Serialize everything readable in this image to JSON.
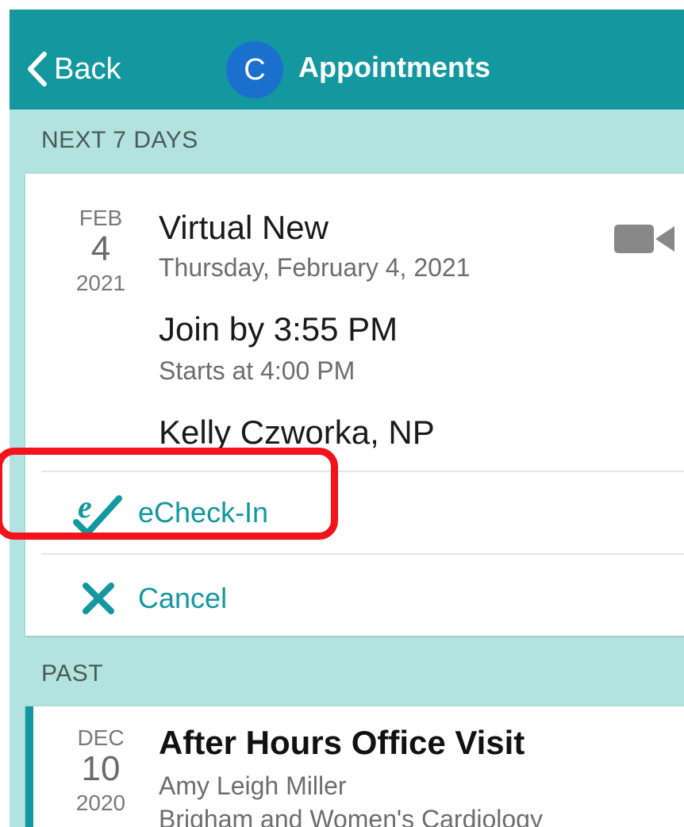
{
  "header": {
    "back_label": "Back",
    "avatar_initial": "C",
    "title": "Appointments",
    "background_color": "#13989f",
    "avatar_color": "#1b6fcd"
  },
  "sections": {
    "next": "NEXT 7 DAYS",
    "past": "PAST"
  },
  "upcoming": {
    "month": "FEB",
    "day": "4",
    "year": "2021",
    "title": "Virtual New",
    "date_long": "Thursday, February 4, 2021",
    "join_by": "Join by 3:55 PM",
    "starts_at": "Starts at 4:00 PM",
    "provider": "Kelly Czworka, NP",
    "type_icon": "video-camera-icon",
    "actions": [
      {
        "label": "eCheck-In",
        "icon": "echeck-in-icon"
      },
      {
        "label": "Cancel",
        "icon": "cancel-x-icon"
      }
    ]
  },
  "past": {
    "month": "DEC",
    "day": "10",
    "year": "2020",
    "title": "After Hours Office Visit",
    "provider": "Amy Leigh Miller",
    "location": "Brigham and Women's Cardiology"
  },
  "colors": {
    "accent": "#13989f",
    "page_background": "#b2e3e0",
    "highlight": "#f2131b"
  }
}
